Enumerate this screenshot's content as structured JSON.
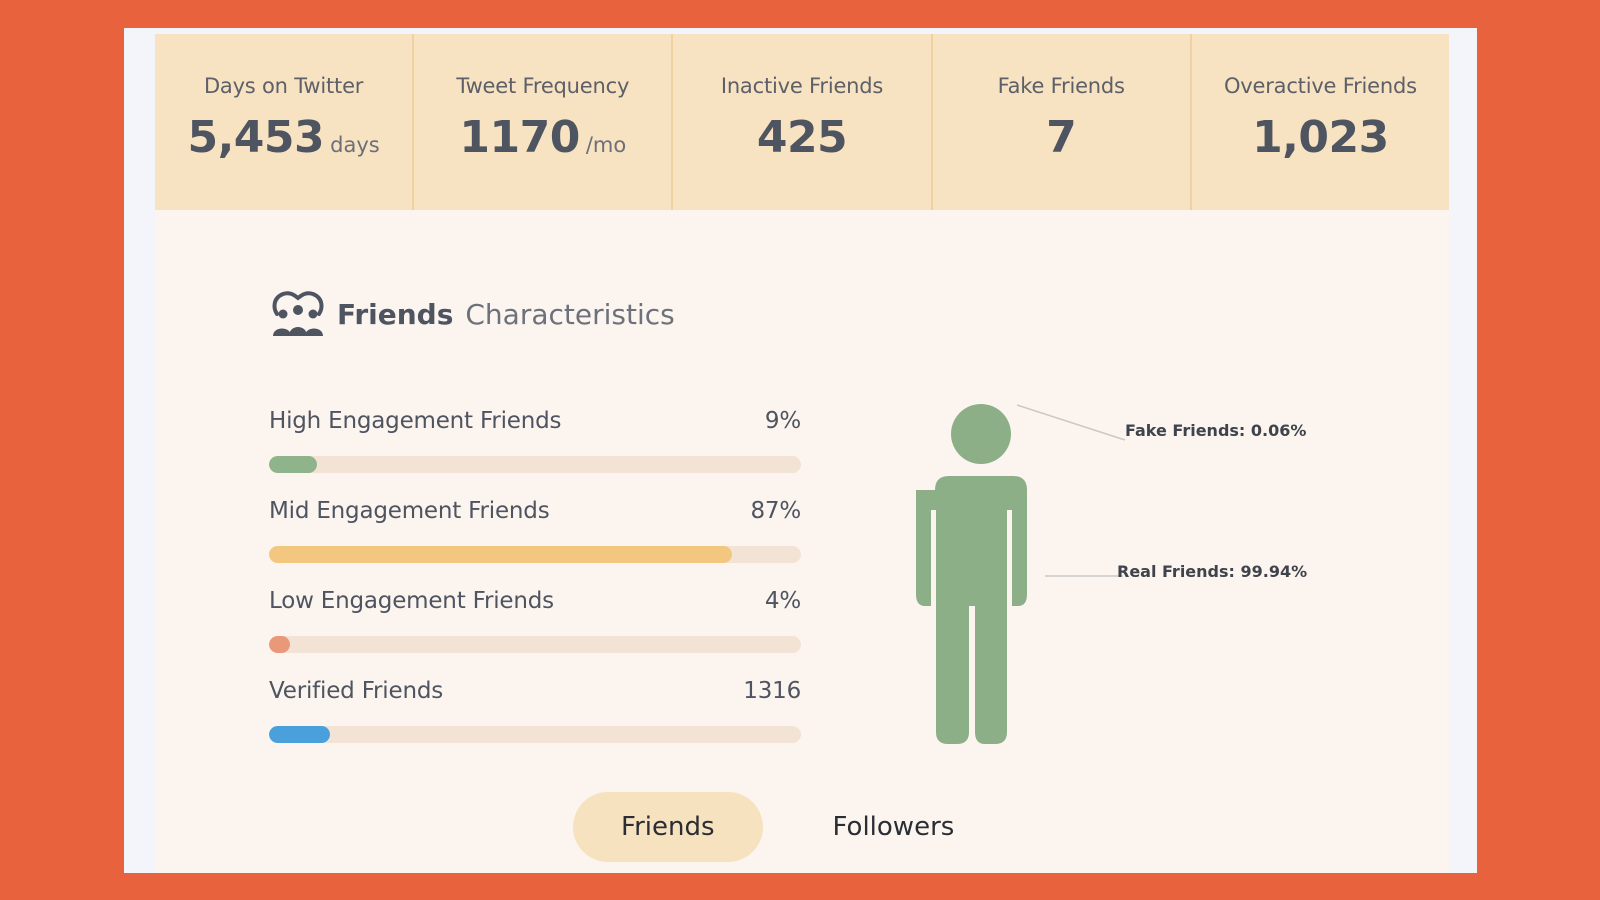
{
  "stats": [
    {
      "label": "Days on Twitter",
      "value": "5,453",
      "unit": "days"
    },
    {
      "label": "Tweet Frequency",
      "value": "1170",
      "unit": "/mo"
    },
    {
      "label": "Inactive Friends",
      "value": "425",
      "unit": ""
    },
    {
      "label": "Fake Friends",
      "value": "7",
      "unit": ""
    },
    {
      "label": "Overactive Friends",
      "value": "1,023",
      "unit": ""
    }
  ],
  "section": {
    "title_strong": "Friends",
    "title_light": "Characteristics",
    "icon": "group-icon"
  },
  "bars": [
    {
      "label": "High Engagement Friends",
      "display": "9%",
      "fill_fraction": 0.09,
      "color": "#8fb48c"
    },
    {
      "label": "Mid Engagement Friends",
      "display": "87%",
      "fill_fraction": 0.87,
      "color": "#f3c77f"
    },
    {
      "label": "Low Engagement Friends",
      "display": "4%",
      "fill_fraction": 0.04,
      "color": "#e9987a"
    },
    {
      "label": "Verified Friends",
      "display": "1316",
      "fill_fraction": 0.115,
      "color": "#4aa0db"
    }
  ],
  "figure": {
    "icon": "person-icon",
    "color": "#8caf88",
    "fake_label": "Fake Friends: 0.06%",
    "real_label": "Real Friends: 99.94%"
  },
  "toggle": {
    "friends_label": "Friends",
    "followers_label": "Followers",
    "active": "friends"
  },
  "colors": {
    "background": "#e8623d",
    "panel": "#fcf5ef",
    "stats_band": "#f7e3c2"
  }
}
